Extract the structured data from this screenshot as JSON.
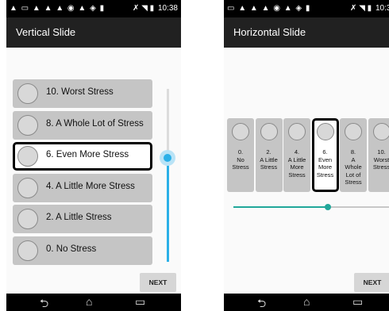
{
  "status_bar": {
    "time": "10:38"
  },
  "left": {
    "title": "Vertical Slide",
    "items": [
      {
        "label": "10. Worst Stress"
      },
      {
        "label": "8. A Whole Lot of Stress"
      },
      {
        "label": "6. Even More Stress"
      },
      {
        "label": "4. A Little More Stress"
      },
      {
        "label": "2. A Little Stress"
      },
      {
        "label": "0. No Stress"
      }
    ],
    "selected_index": 2,
    "slider_fraction": 0.6,
    "next_label": "NEXT"
  },
  "right": {
    "title": "Horizontal Slide",
    "items": [
      {
        "label": "0.\nNo\nStress"
      },
      {
        "label": "2.\nA Little\nStress"
      },
      {
        "label": "4.\nA Little\nMore\nStress"
      },
      {
        "label": "6.\nEven\nMore\nStress"
      },
      {
        "label": "8.\nA\nWhole\nLot of\nStress"
      },
      {
        "label": "10.\nWorst\nStress"
      }
    ],
    "selected_index": 3,
    "slider_fraction": 0.6,
    "next_label": "NEXT"
  },
  "colors": {
    "vertical_accent": "#2bb0e8",
    "horizontal_accent": "#21a79a",
    "item_background": "#c5c5c5"
  },
  "icons": {
    "face": "face-icon",
    "back": "back-icon",
    "home": "home-icon",
    "recents": "recents-icon"
  }
}
